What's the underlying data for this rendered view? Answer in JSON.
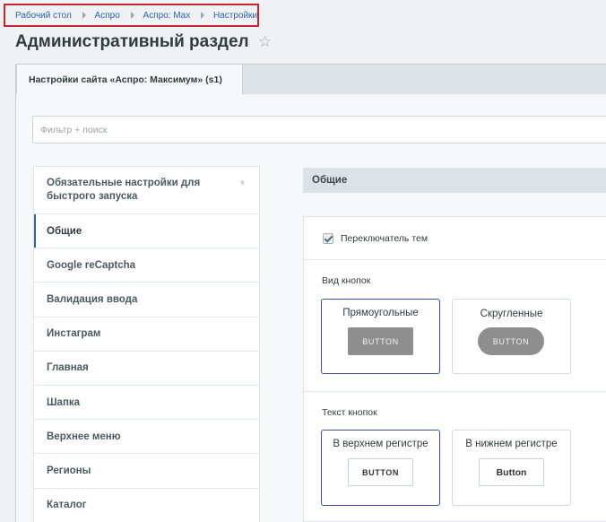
{
  "breadcrumb": [
    "Рабочий стол",
    "Аспро",
    "Аспро: Max",
    "Настройки"
  ],
  "header": {
    "title": "Административный раздел"
  },
  "tabs": [
    {
      "label": "Настройки сайта «Аспро: Максимум» (s1)"
    }
  ],
  "filter": {
    "placeholder": "Фильтр + поиск",
    "value": ""
  },
  "sidebar": {
    "items": [
      {
        "label": "Обязательные настройки для быстрого запуска",
        "badge": "*"
      },
      {
        "label": "Общие",
        "active": true
      },
      {
        "label": "Google reCaptcha"
      },
      {
        "label": "Валидация ввода"
      },
      {
        "label": "Инстаграм"
      },
      {
        "label": "Главная"
      },
      {
        "label": "Шапка"
      },
      {
        "label": "Верхнее меню"
      },
      {
        "label": "Регионы"
      },
      {
        "label": "Каталог"
      }
    ]
  },
  "section": {
    "title": "Общие",
    "theme_switcher": {
      "label": "Переключатель тем",
      "checked": true
    },
    "button_style": {
      "label": "Вид кнопок",
      "options": [
        {
          "title": "Прямоугольные",
          "sample": "BUTTON",
          "selected": true
        },
        {
          "title": "Скругленные",
          "sample": "BUTTON",
          "selected": false
        }
      ]
    },
    "button_text": {
      "label": "Текст кнопок",
      "options": [
        {
          "title": "В верхнем регистре",
          "sample": "BUTTON",
          "selected": true
        },
        {
          "title": "В нижнем регистре",
          "sample": "Button",
          "selected": false
        }
      ]
    }
  },
  "colors": {
    "accent": "#2b66a6",
    "highlight_border": "#c8252c",
    "selected_card": "#3d4fa0"
  }
}
